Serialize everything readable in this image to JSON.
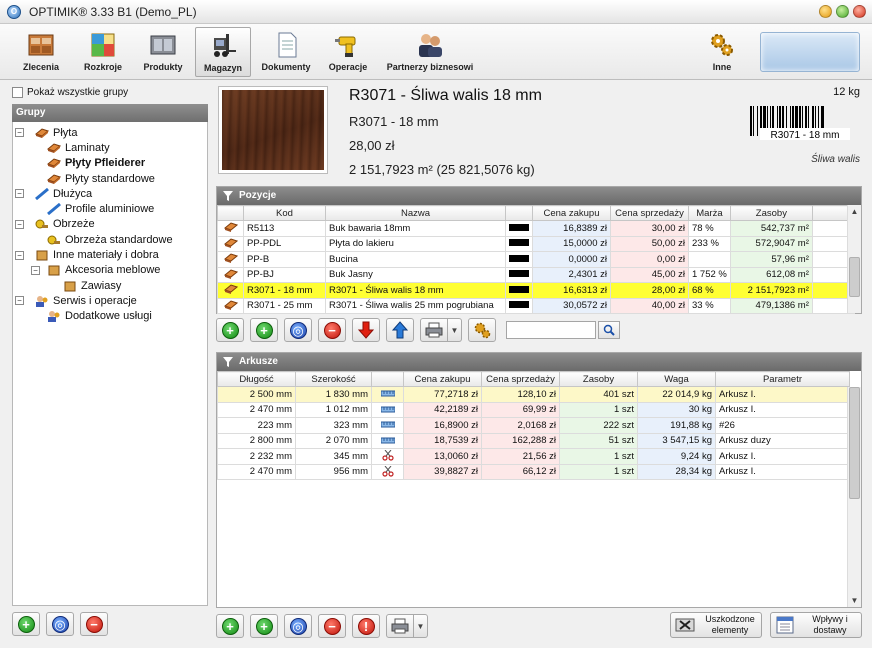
{
  "window": {
    "title": "OPTIMIK® 3.33 B1  (Demo_PL)"
  },
  "toolbar": {
    "items": [
      {
        "label": "Zlecenia",
        "icon": "orders-icon"
      },
      {
        "label": "Rozkroje",
        "icon": "cutting-icon"
      },
      {
        "label": "Produkty",
        "icon": "products-icon"
      },
      {
        "label": "Magazyn",
        "icon": "warehouse-icon",
        "active": true
      },
      {
        "label": "Dokumenty",
        "icon": "documents-icon"
      },
      {
        "label": "Operacje",
        "icon": "drill-icon"
      },
      {
        "label": "Partnerzy biznesowi",
        "icon": "partners-icon"
      }
    ],
    "other_label": "Inne"
  },
  "left": {
    "show_all_label": "Pokaż wszystkie grupy",
    "groups_header": "Grupy",
    "tree": [
      {
        "label": "Płyta",
        "level": 0,
        "expanded": true
      },
      {
        "label": "Laminaty",
        "level": 1
      },
      {
        "label": "Płyty Pfleiderer",
        "level": 1,
        "selected": true
      },
      {
        "label": "Płyty standardowe",
        "level": 1
      },
      {
        "label": "Dłużyca",
        "level": 0,
        "expanded": true
      },
      {
        "label": "Profile aluminiowe",
        "level": 1
      },
      {
        "label": "Obrzeże",
        "level": 0,
        "expanded": true
      },
      {
        "label": "Obrzeża standardowe",
        "level": 1
      },
      {
        "label": "Inne materiały i dobra",
        "level": 0,
        "expanded": true
      },
      {
        "label": "Akcesoria meblowe",
        "level": 1,
        "expanded": true
      },
      {
        "label": "Zawiasy",
        "level": 2
      },
      {
        "label": "Serwis i operacje",
        "level": 0,
        "expanded": true
      },
      {
        "label": "Dodatkowe usługi",
        "level": 1
      }
    ]
  },
  "product": {
    "title": "R3071 - Śliwa walis 18 mm",
    "code": "R3071 - 18 mm",
    "price": "28,00 zł",
    "quantity": "2 151,7923 m² (25 821,5076 kg)",
    "weight": "12 kg",
    "barcode_text": "R3071 - 18 mm",
    "decor_name": "Śliwa walis"
  },
  "positions": {
    "header": "Pozycje",
    "columns": [
      "Kod",
      "Nazwa",
      "",
      "Cena zakupu",
      "Cena sprzedaży",
      "Marża",
      "Zasoby"
    ],
    "rows": [
      {
        "kod": "R5113",
        "nazwa": "Buk bawaria 18mm",
        "zakup": "16,8389 zł",
        "sprzedaz": "30,00 zł",
        "marza": "78 %",
        "zasoby": "542,737 m²"
      },
      {
        "kod": "PP-PDL",
        "nazwa": "Płyta do lakieru",
        "zakup": "15,0000 zł",
        "sprzedaz": "50,00 zł",
        "marza": "233 %",
        "zasoby": "572,9047 m²"
      },
      {
        "kod": "PP-B",
        "nazwa": "Bucina",
        "zakup": "0,0000 zł",
        "sprzedaz": "0,00 zł",
        "marza": "",
        "zasoby": "57,96 m²"
      },
      {
        "kod": "PP-BJ",
        "nazwa": "Buk Jasny",
        "zakup": "2,4301 zł",
        "sprzedaz": "45,00 zł",
        "marza": "1 752 %",
        "zasoby": "612,08 m²"
      },
      {
        "kod": "R3071 - 18 mm",
        "nazwa": "R3071 - Śliwa walis 18 mm",
        "zakup": "16,6313 zł",
        "sprzedaz": "28,00 zł",
        "marza": "68 %",
        "zasoby": "2 151,7923 m²",
        "selected": true
      },
      {
        "kod": "R3071 - 25 mm",
        "nazwa": "R3071 - Śliwa walis 25 mm pogrubiana",
        "zakup": "30,0572 zł",
        "sprzedaz": "40,00 zł",
        "marza": "33 %",
        "zasoby": "479,1386 m²"
      }
    ]
  },
  "sheets": {
    "header": "Arkusze",
    "columns": [
      "Długość",
      "Szerokość",
      "",
      "Cena zakupu",
      "Cena sprzedaży",
      "Zasoby",
      "Waga",
      "Parametr"
    ],
    "rows": [
      {
        "dl": "2 500 mm",
        "sz": "1 830 mm",
        "icon": "ruler",
        "zakup": "77,2718 zł",
        "sprzedaz": "128,10 zł",
        "zasoby": "401 szt",
        "waga": "22 014,9 kg",
        "param": "Arkusz I.",
        "highlight": true
      },
      {
        "dl": "2 470 mm",
        "sz": "1 012 mm",
        "icon": "ruler",
        "zakup": "42,2189 zł",
        "sprzedaz": "69,99 zł",
        "zasoby": "1 szt",
        "waga": "30 kg",
        "param": "Arkusz I."
      },
      {
        "dl": "223 mm",
        "sz": "323 mm",
        "icon": "ruler",
        "zakup": "16,8900 zł",
        "sprzedaz": "2,0168 zł",
        "zasoby": "222 szt",
        "waga": "191,88 kg",
        "param": "#26"
      },
      {
        "dl": "2 800 mm",
        "sz": "2 070 mm",
        "icon": "ruler",
        "zakup": "18,7539 zł",
        "sprzedaz": "162,288 zł",
        "zasoby": "51 szt",
        "waga": "3 547,15 kg",
        "param": "Arkusz duzy"
      },
      {
        "dl": "2 232 mm",
        "sz": "345 mm",
        "icon": "scissors",
        "zakup": "13,0060 zł",
        "sprzedaz": "21,56 zł",
        "zasoby": "1 szt",
        "waga": "9,24 kg",
        "param": "Arkusz I."
      },
      {
        "dl": "2 470 mm",
        "sz": "956 mm",
        "icon": "scissors",
        "zakup": "39,8827 zł",
        "sprzedaz": "66,12 zł",
        "zasoby": "1 szt",
        "waga": "28,34 kg",
        "param": "Arkusz I."
      }
    ]
  },
  "bottom": {
    "damaged_label_1": "Uszkodzone",
    "damaged_label_2": "elementy",
    "flows_label_1": "Wpływy i",
    "flows_label_2": "dostawy"
  },
  "colors": {
    "accent_green": "#128a12",
    "accent_red": "#c0140a",
    "accent_blue": "#1a3fa8",
    "selection": "#ffff33"
  }
}
